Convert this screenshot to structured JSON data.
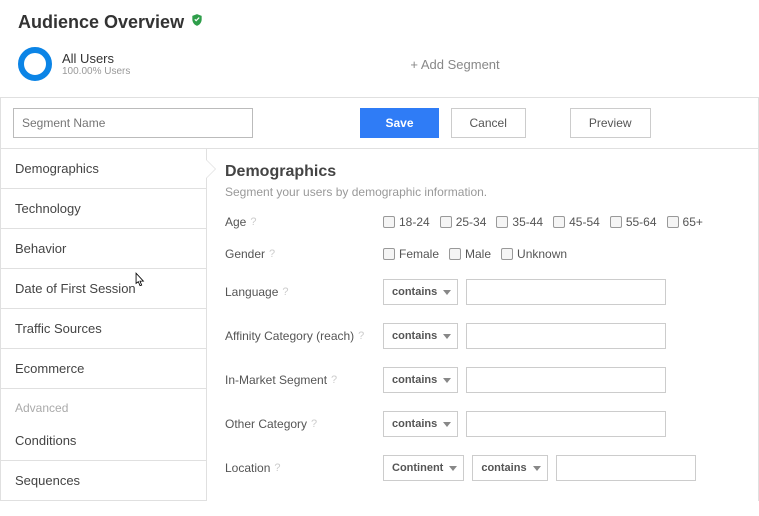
{
  "header": {
    "title": "Audience Overview"
  },
  "segment": {
    "name": "All Users",
    "sub": "100.00% Users",
    "add": "+ Add Segment"
  },
  "toolbar": {
    "placeholder": "Segment Name",
    "save": "Save",
    "cancel": "Cancel",
    "preview": "Preview"
  },
  "sidebar": {
    "items": [
      "Demographics",
      "Technology",
      "Behavior",
      "Date of First Session",
      "Traffic Sources",
      "Ecommerce"
    ],
    "advanced_label": "Advanced",
    "advanced": [
      "Conditions",
      "Sequences"
    ]
  },
  "demographics": {
    "title": "Demographics",
    "sub": "Segment your users by demographic information.",
    "rows": {
      "age": {
        "label": "Age",
        "options": [
          "18-24",
          "25-34",
          "35-44",
          "45-54",
          "55-64",
          "65+"
        ]
      },
      "gender": {
        "label": "Gender",
        "options": [
          "Female",
          "Male",
          "Unknown"
        ]
      },
      "language": {
        "label": "Language",
        "op": "contains"
      },
      "affinity": {
        "label": "Affinity Category (reach)",
        "op": "contains"
      },
      "inmarket": {
        "label": "In-Market Segment",
        "op": "contains"
      },
      "other": {
        "label": "Other Category",
        "op": "contains"
      },
      "location": {
        "label": "Location",
        "dim": "Continent",
        "op": "contains"
      }
    }
  }
}
